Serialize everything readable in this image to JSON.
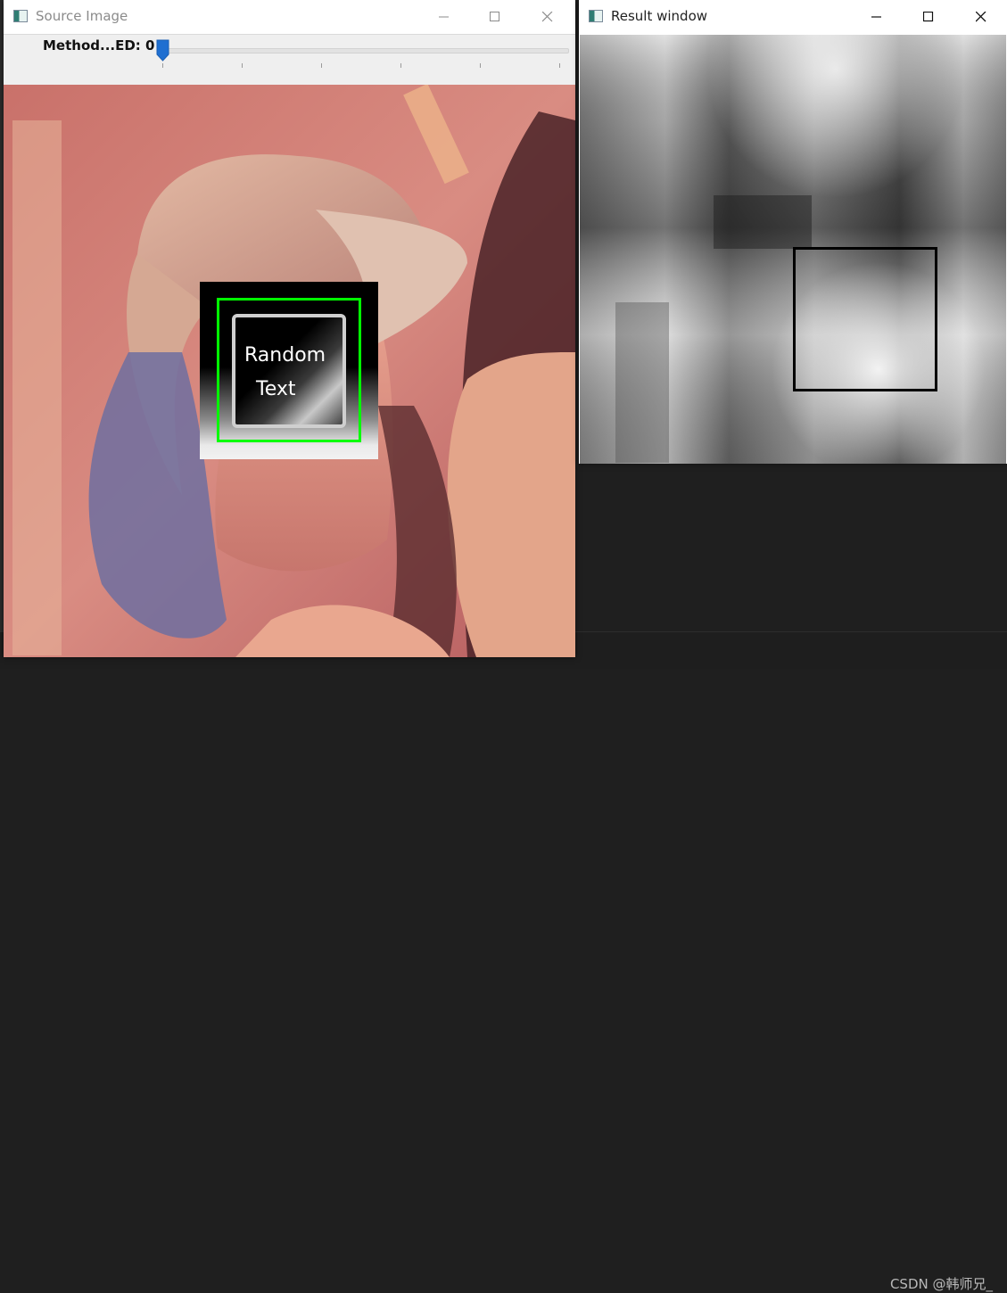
{
  "source_window": {
    "title": "Source Image",
    "trackbar": {
      "label": "Method...ED: 0",
      "value": 0
    },
    "overlay_text": [
      "Random",
      "Text"
    ]
  },
  "result_window": {
    "title": "Result window"
  },
  "watermark": "CSDN @韩师兄_",
  "colors": {
    "match_border_source": "#00ff00",
    "match_border_result": "#000000",
    "slider_thumb": "#1f6fd1"
  },
  "icons": [
    "app-icon",
    "minimize-icon",
    "maximize-icon",
    "close-icon",
    "slider-thumb-icon"
  ]
}
